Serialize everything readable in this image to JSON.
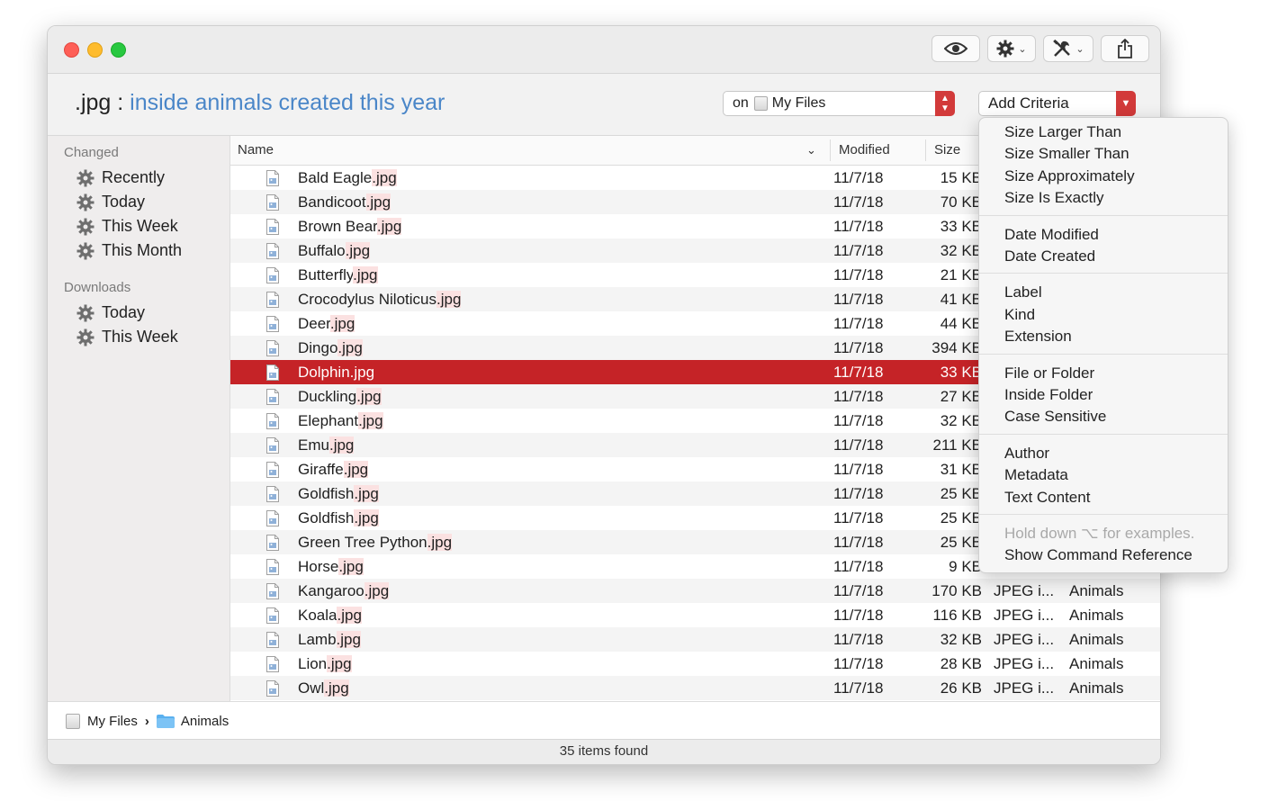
{
  "window": {
    "toolbar": {
      "quicklook_icon": "eye-icon",
      "action_icon": "gear-icon",
      "tools_icon": "tools-icon",
      "share_icon": "share-icon"
    }
  },
  "query": {
    "extension": ".jpg",
    "separator": ":",
    "description": "inside animals created this year",
    "scope_prefix": "on",
    "scope_name": "My Files",
    "add_criteria_label": "Add Criteria"
  },
  "sidebar": {
    "changed_heading": "Changed",
    "changed_items": [
      "Recently",
      "Today",
      "This Week",
      "This Month"
    ],
    "downloads_heading": "Downloads",
    "downloads_items": [
      "Today",
      "This Week"
    ]
  },
  "columns": {
    "name": "Name",
    "modified": "Modified",
    "size": "Size"
  },
  "files": [
    {
      "stem": "Bald Eagle",
      "ext": ".jpg",
      "modified": "11/7/18",
      "size": "15 KB",
      "kind": "",
      "where": ""
    },
    {
      "stem": "Bandicoot",
      "ext": ".jpg",
      "modified": "11/7/18",
      "size": "70 KB",
      "kind": "",
      "where": ""
    },
    {
      "stem": "Brown Bear",
      "ext": ".jpg",
      "modified": "11/7/18",
      "size": "33 KB",
      "kind": "",
      "where": ""
    },
    {
      "stem": "Buffalo",
      "ext": ".jpg",
      "modified": "11/7/18",
      "size": "32 KB",
      "kind": "",
      "where": ""
    },
    {
      "stem": "Butterfly",
      "ext": ".jpg",
      "modified": "11/7/18",
      "size": "21 KB",
      "kind": "",
      "where": ""
    },
    {
      "stem": "Crocodylus Niloticus",
      "ext": ".jpg",
      "modified": "11/7/18",
      "size": "41 KB",
      "kind": "",
      "where": ""
    },
    {
      "stem": "Deer",
      "ext": ".jpg",
      "modified": "11/7/18",
      "size": "44 KB",
      "kind": "",
      "where": ""
    },
    {
      "stem": "Dingo",
      "ext": ".jpg",
      "modified": "11/7/18",
      "size": "394 KB",
      "kind": "",
      "where": ""
    },
    {
      "stem": "Dolphin",
      "ext": ".jpg",
      "modified": "11/7/18",
      "size": "33 KB",
      "kind": "",
      "where": "",
      "selected": true
    },
    {
      "stem": "Duckling",
      "ext": ".jpg",
      "modified": "11/7/18",
      "size": "27 KB",
      "kind": "",
      "where": ""
    },
    {
      "stem": "Elephant",
      "ext": ".jpg",
      "modified": "11/7/18",
      "size": "32 KB",
      "kind": "",
      "where": ""
    },
    {
      "stem": "Emu",
      "ext": ".jpg",
      "modified": "11/7/18",
      "size": "211 KB",
      "kind": "",
      "where": ""
    },
    {
      "stem": "Giraffe",
      "ext": ".jpg",
      "modified": "11/7/18",
      "size": "31 KB",
      "kind": "",
      "where": ""
    },
    {
      "stem": "Goldfish",
      "ext": ".jpg",
      "modified": "11/7/18",
      "size": "25 KB",
      "kind": "",
      "where": ""
    },
    {
      "stem": "Goldfish",
      "ext": ".jpg",
      "modified": "11/7/18",
      "size": "25 KB",
      "kind": "",
      "where": ""
    },
    {
      "stem": "Green Tree Python",
      "ext": ".jpg",
      "modified": "11/7/18",
      "size": "25 KB",
      "kind": "",
      "where": ""
    },
    {
      "stem": "Horse",
      "ext": ".jpg",
      "modified": "11/7/18",
      "size": "9 KB",
      "kind": "",
      "where": ""
    },
    {
      "stem": "Kangaroo",
      "ext": ".jpg",
      "modified": "11/7/18",
      "size": "170 KB",
      "kind": "JPEG i...",
      "where": "Animals"
    },
    {
      "stem": "Koala",
      "ext": ".jpg",
      "modified": "11/7/18",
      "size": "116 KB",
      "kind": "JPEG i...",
      "where": "Animals"
    },
    {
      "stem": "Lamb",
      "ext": ".jpg",
      "modified": "11/7/18",
      "size": "32 KB",
      "kind": "JPEG i...",
      "where": "Animals"
    },
    {
      "stem": "Lion",
      "ext": ".jpg",
      "modified": "11/7/18",
      "size": "28 KB",
      "kind": "JPEG i...",
      "where": "Animals"
    },
    {
      "stem": "Owl",
      "ext": ".jpg",
      "modified": "11/7/18",
      "size": "26 KB",
      "kind": "JPEG i...",
      "where": "Animals"
    }
  ],
  "pathbar": {
    "root": "My Files",
    "separator": "›",
    "folder": "Animals"
  },
  "status": {
    "text": "35 items found"
  },
  "menu": {
    "groups": [
      [
        "Size Larger Than",
        "Size Smaller Than",
        "Size Approximately",
        "Size Is Exactly"
      ],
      [
        "Date Modified",
        "Date Created"
      ],
      [
        "Label",
        "Kind",
        "Extension"
      ],
      [
        "File or Folder",
        "Inside Folder",
        "Case Sensitive"
      ],
      [
        "Author",
        "Metadata",
        "Text Content"
      ]
    ],
    "hint": "Hold down ⌥ for examples.",
    "reference": "Show Command Reference"
  },
  "colors": {
    "accent_red": "#c52327",
    "query_blue": "#4a86c8",
    "highlight_pink": "#fbe1e1"
  }
}
